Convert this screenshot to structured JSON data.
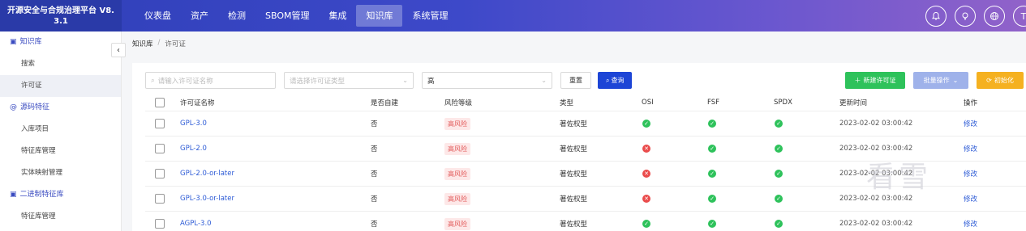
{
  "brand": {
    "line1": "开源安全与合规治理平台 V8.",
    "line2": "3.1"
  },
  "nav": [
    "仪表盘",
    "资产",
    "检测",
    "SBOM管理",
    "集成",
    "知识库",
    "系统管理"
  ],
  "nav_active": "知识库",
  "top_icons": [
    "bell-icon",
    "lightbulb-icon",
    "globe-icon"
  ],
  "avatar_letter": "T",
  "sidebar": {
    "group1": "知识库",
    "items1": [
      "搜索",
      "许可证"
    ],
    "group2": "源码特征",
    "items2": [
      "入库项目",
      "特征库管理",
      "实体映射管理"
    ],
    "group3": "二进制特征库",
    "items3": [
      "特征库管理"
    ]
  },
  "breadcrumb": {
    "root": "知识库",
    "sep": "/",
    "current": "许可证"
  },
  "filters": {
    "name_placeholder": "请输入许可证名称",
    "type_placeholder": "请选择许可证类型",
    "risk_value": "高",
    "reset_label": "重置",
    "query_label": "查询"
  },
  "actions": {
    "new_label": "新建许可证",
    "batch_label": "批量操作",
    "init_label": "初始化"
  },
  "table": {
    "headers": [
      "许可证名称",
      "是否自建",
      "风险等级",
      "类型",
      "OSI",
      "FSF",
      "SPDX",
      "更新时间",
      "操作"
    ],
    "rows": [
      {
        "name": "GPL-3.0",
        "custom": "否",
        "risk": "高风险",
        "type": "著佐权型",
        "osi": "ok",
        "fsf": "ok",
        "spdx": "ok",
        "time": "2023-02-02 03:00:42",
        "op": "修改"
      },
      {
        "name": "GPL-2.0",
        "custom": "否",
        "risk": "高风险",
        "type": "著佐权型",
        "osi": "bad",
        "fsf": "ok",
        "spdx": "ok",
        "time": "2023-02-02 03:00:42",
        "op": "修改"
      },
      {
        "name": "GPL-2.0-or-later",
        "custom": "否",
        "risk": "高风险",
        "type": "著佐权型",
        "osi": "bad",
        "fsf": "ok",
        "spdx": "ok",
        "time": "2023-02-02 03:00:42",
        "op": "修改"
      },
      {
        "name": "GPL-3.0-or-later",
        "custom": "否",
        "risk": "高风险",
        "type": "著佐权型",
        "osi": "bad",
        "fsf": "ok",
        "spdx": "ok",
        "time": "2023-02-02 03:00:42",
        "op": "修改"
      },
      {
        "name": "AGPL-3.0",
        "custom": "否",
        "risk": "高风险",
        "type": "著佐权型",
        "osi": "ok",
        "fsf": "ok",
        "spdx": "ok",
        "time": "2023-02-02 03:00:42",
        "op": "修改"
      }
    ]
  },
  "watermark": "看雪",
  "colors": {
    "nav_start": "#2f3fb8",
    "nav_end": "#9162c9",
    "primary": "#1d45d6",
    "success": "#2ec25b",
    "danger": "#ea4b4b",
    "warning": "#f5b120"
  }
}
